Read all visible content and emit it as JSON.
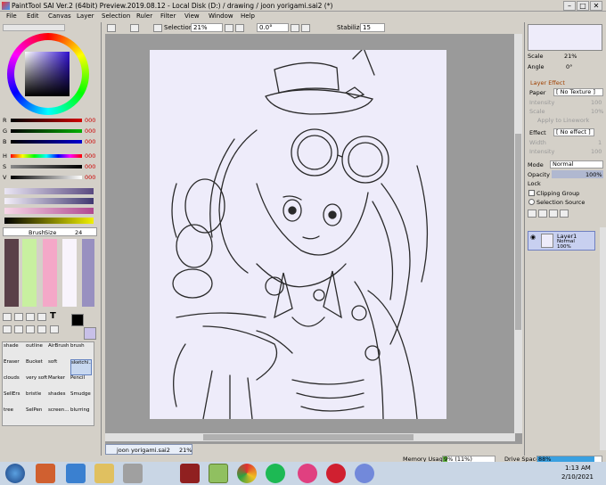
{
  "window": {
    "title": "PaintTool SAI Ver.2 (64bit) Preview.2019.08.12 - Local Disk (D:) / drawing / joon yorigami.sai2 (*)",
    "min": "–",
    "max": "□",
    "close": "✕"
  },
  "menu": [
    "File",
    "Edit",
    "Canvas",
    "Layer",
    "Selection",
    "Ruler",
    "Filter",
    "View",
    "Window",
    "Help"
  ],
  "toolbar": {
    "selection_label": "Selection",
    "zoom": "21%",
    "rotation": "0.0°",
    "stabilizer_label": "Stabilizer",
    "stabilizer_value": "15"
  },
  "color_sliders": [
    {
      "label": "R",
      "value": "000",
      "color": "#d00000"
    },
    {
      "label": "G",
      "value": "000",
      "color": "#00b000"
    },
    {
      "label": "B",
      "value": "000",
      "color": "#0000d0"
    },
    {
      "label": "H",
      "value": "000",
      "color": "#ff0000"
    },
    {
      "label": "S",
      "value": "000",
      "color": "#888888"
    },
    {
      "label": "V",
      "value": "000",
      "color": "#444444"
    }
  ],
  "brush_size": {
    "label": "Brush",
    "size_label": "Size",
    "value": "24"
  },
  "swatches": [
    "#5a4048",
    "#c8f0a0",
    "#f4a8c8",
    "#f8f4fc",
    "#9890c0"
  ],
  "brushes": [
    [
      "shade",
      "outline",
      "AirBrush",
      "brush"
    ],
    [
      "Eraser",
      "Bucket",
      "soft",
      "sketchi..."
    ],
    [
      "clouds",
      "very soft",
      "Marker",
      "Pencil"
    ],
    [
      "SellErs",
      "bristle",
      "shades",
      "Smudge"
    ],
    [
      "tree",
      "SelPen",
      "screen...",
      "blurring"
    ]
  ],
  "navigator": {
    "scale_label": "Scale",
    "scale_value": "21%",
    "angle_label": "Angle",
    "angle_value": "0°"
  },
  "layer_effect": {
    "header": "Layer Effect",
    "paper_label": "Paper",
    "paper_value": "[ No Texture ]",
    "intensity_label": "Intensity",
    "intensity_value": "100",
    "scale_label": "Scale",
    "scale_value": "10%",
    "apply_linework": "Apply to Linework",
    "effect_label": "Effect",
    "effect_value": "[ No effect ]",
    "width_label": "Width",
    "width_value": "1",
    "effect_intensity_label": "Intensity",
    "effect_intensity_value": "100"
  },
  "layer_props": {
    "mode_label": "Mode",
    "mode_value": "Normal",
    "opacity_label": "Opacity",
    "opacity_value": "100%",
    "lock_label": "Lock",
    "clipping_group": "Clipping Group",
    "selection_source": "Selection Source"
  },
  "layer": {
    "name": "Layer1",
    "mode": "Normal",
    "opacity": "100%"
  },
  "doc_tab": {
    "name": "joon yorigami.sai2",
    "zoom": "21%"
  },
  "status": {
    "memory_label": "Memory Usage",
    "memory_value": "9% (11%)",
    "drive_label": "Drive Space",
    "drive_value": "88%"
  },
  "taskbar": {
    "time": "1:13 AM",
    "date": "2/10/2021"
  }
}
